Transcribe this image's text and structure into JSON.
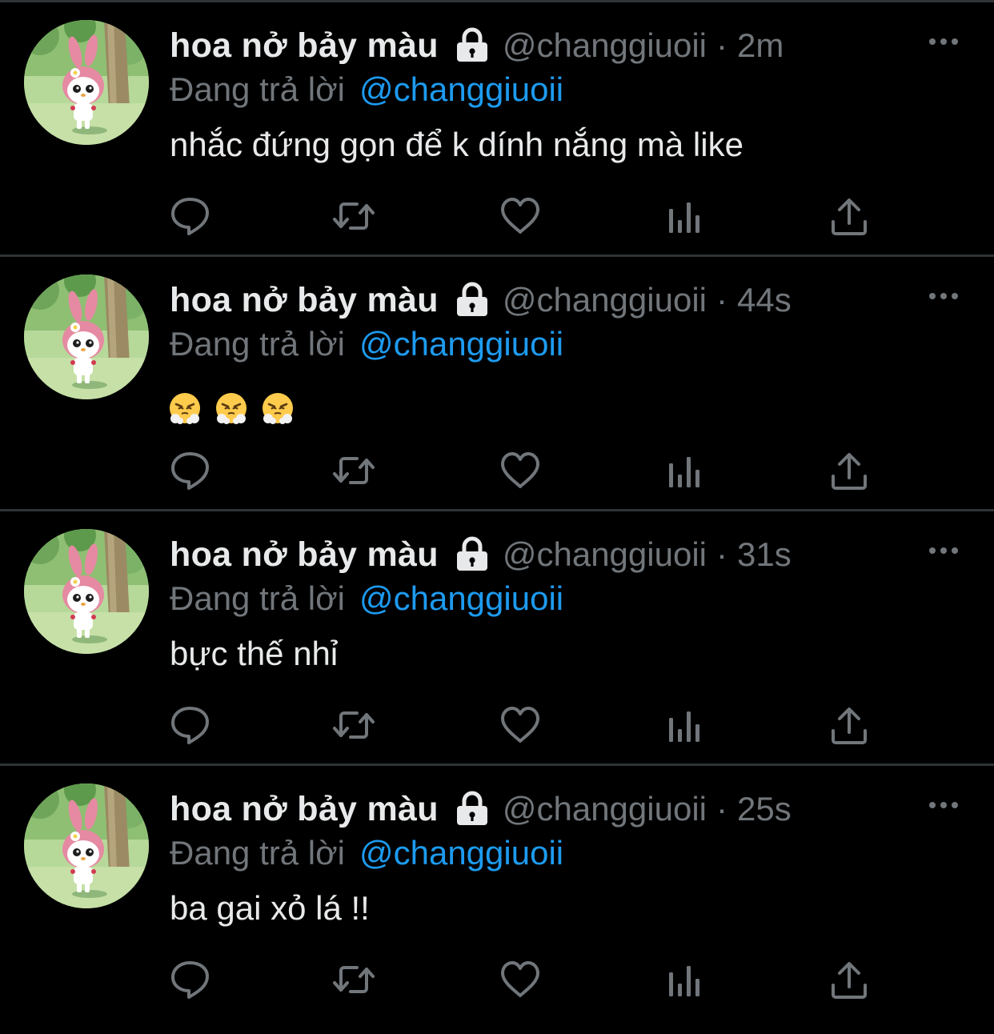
{
  "colors": {
    "background": "#000000",
    "divider": "#2f3336",
    "primary_text": "#e7e9ea",
    "secondary_text": "#71767b",
    "link": "#1d9bf0"
  },
  "icons": {
    "avatar": "my-melody-avatar",
    "lock": "lock-icon",
    "more": "more-dots-icon",
    "reply": "reply-icon",
    "retweet": "retweet-icon",
    "like": "heart-icon",
    "views": "views-chart-icon",
    "share": "share-icon",
    "emoji": "face-with-steam-emoji"
  },
  "tweets": [
    {
      "display_name": "hoa nở bảy màu",
      "handle": "@changgiuoii",
      "separator": "·",
      "time": "2m",
      "reply_label": "Đang trả lời",
      "reply_to": "@changgiuoii",
      "text": "nhắc đứng gọn để k dính nắng mà like",
      "emoji_count": 0
    },
    {
      "display_name": "hoa nở bảy màu",
      "handle": "@changgiuoii",
      "separator": "·",
      "time": "44s",
      "reply_label": "Đang trả lời",
      "reply_to": "@changgiuoii",
      "text": "",
      "emoji_count": 3
    },
    {
      "display_name": "hoa nở bảy màu",
      "handle": "@changgiuoii",
      "separator": "·",
      "time": "31s",
      "reply_label": "Đang trả lời",
      "reply_to": "@changgiuoii",
      "text": "bực thế nhỉ",
      "emoji_count": 0
    },
    {
      "display_name": "hoa nở bảy màu",
      "handle": "@changgiuoii",
      "separator": "·",
      "time": "25s",
      "reply_label": "Đang trả lời",
      "reply_to": "@changgiuoii",
      "text": "ba gai xỏ lá !!",
      "emoji_count": 0
    }
  ]
}
